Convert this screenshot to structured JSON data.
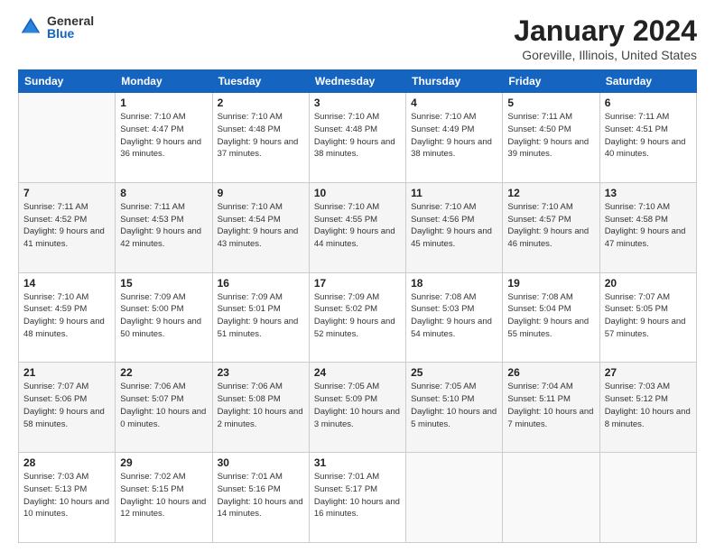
{
  "logo": {
    "general": "General",
    "blue": "Blue"
  },
  "title": {
    "month": "January 2024",
    "location": "Goreville, Illinois, United States"
  },
  "days_of_week": [
    "Sunday",
    "Monday",
    "Tuesday",
    "Wednesday",
    "Thursday",
    "Friday",
    "Saturday"
  ],
  "weeks": [
    [
      {
        "day": "",
        "sunrise": "",
        "sunset": "",
        "daylight": ""
      },
      {
        "day": "1",
        "sunrise": "Sunrise: 7:10 AM",
        "sunset": "Sunset: 4:47 PM",
        "daylight": "Daylight: 9 hours and 36 minutes."
      },
      {
        "day": "2",
        "sunrise": "Sunrise: 7:10 AM",
        "sunset": "Sunset: 4:48 PM",
        "daylight": "Daylight: 9 hours and 37 minutes."
      },
      {
        "day": "3",
        "sunrise": "Sunrise: 7:10 AM",
        "sunset": "Sunset: 4:48 PM",
        "daylight": "Daylight: 9 hours and 38 minutes."
      },
      {
        "day": "4",
        "sunrise": "Sunrise: 7:10 AM",
        "sunset": "Sunset: 4:49 PM",
        "daylight": "Daylight: 9 hours and 38 minutes."
      },
      {
        "day": "5",
        "sunrise": "Sunrise: 7:11 AM",
        "sunset": "Sunset: 4:50 PM",
        "daylight": "Daylight: 9 hours and 39 minutes."
      },
      {
        "day": "6",
        "sunrise": "Sunrise: 7:11 AM",
        "sunset": "Sunset: 4:51 PM",
        "daylight": "Daylight: 9 hours and 40 minutes."
      }
    ],
    [
      {
        "day": "7",
        "sunrise": "Sunrise: 7:11 AM",
        "sunset": "Sunset: 4:52 PM",
        "daylight": "Daylight: 9 hours and 41 minutes."
      },
      {
        "day": "8",
        "sunrise": "Sunrise: 7:11 AM",
        "sunset": "Sunset: 4:53 PM",
        "daylight": "Daylight: 9 hours and 42 minutes."
      },
      {
        "day": "9",
        "sunrise": "Sunrise: 7:10 AM",
        "sunset": "Sunset: 4:54 PM",
        "daylight": "Daylight: 9 hours and 43 minutes."
      },
      {
        "day": "10",
        "sunrise": "Sunrise: 7:10 AM",
        "sunset": "Sunset: 4:55 PM",
        "daylight": "Daylight: 9 hours and 44 minutes."
      },
      {
        "day": "11",
        "sunrise": "Sunrise: 7:10 AM",
        "sunset": "Sunset: 4:56 PM",
        "daylight": "Daylight: 9 hours and 45 minutes."
      },
      {
        "day": "12",
        "sunrise": "Sunrise: 7:10 AM",
        "sunset": "Sunset: 4:57 PM",
        "daylight": "Daylight: 9 hours and 46 minutes."
      },
      {
        "day": "13",
        "sunrise": "Sunrise: 7:10 AM",
        "sunset": "Sunset: 4:58 PM",
        "daylight": "Daylight: 9 hours and 47 minutes."
      }
    ],
    [
      {
        "day": "14",
        "sunrise": "Sunrise: 7:10 AM",
        "sunset": "Sunset: 4:59 PM",
        "daylight": "Daylight: 9 hours and 48 minutes."
      },
      {
        "day": "15",
        "sunrise": "Sunrise: 7:09 AM",
        "sunset": "Sunset: 5:00 PM",
        "daylight": "Daylight: 9 hours and 50 minutes."
      },
      {
        "day": "16",
        "sunrise": "Sunrise: 7:09 AM",
        "sunset": "Sunset: 5:01 PM",
        "daylight": "Daylight: 9 hours and 51 minutes."
      },
      {
        "day": "17",
        "sunrise": "Sunrise: 7:09 AM",
        "sunset": "Sunset: 5:02 PM",
        "daylight": "Daylight: 9 hours and 52 minutes."
      },
      {
        "day": "18",
        "sunrise": "Sunrise: 7:08 AM",
        "sunset": "Sunset: 5:03 PM",
        "daylight": "Daylight: 9 hours and 54 minutes."
      },
      {
        "day": "19",
        "sunrise": "Sunrise: 7:08 AM",
        "sunset": "Sunset: 5:04 PM",
        "daylight": "Daylight: 9 hours and 55 minutes."
      },
      {
        "day": "20",
        "sunrise": "Sunrise: 7:07 AM",
        "sunset": "Sunset: 5:05 PM",
        "daylight": "Daylight: 9 hours and 57 minutes."
      }
    ],
    [
      {
        "day": "21",
        "sunrise": "Sunrise: 7:07 AM",
        "sunset": "Sunset: 5:06 PM",
        "daylight": "Daylight: 9 hours and 58 minutes."
      },
      {
        "day": "22",
        "sunrise": "Sunrise: 7:06 AM",
        "sunset": "Sunset: 5:07 PM",
        "daylight": "Daylight: 10 hours and 0 minutes."
      },
      {
        "day": "23",
        "sunrise": "Sunrise: 7:06 AM",
        "sunset": "Sunset: 5:08 PM",
        "daylight": "Daylight: 10 hours and 2 minutes."
      },
      {
        "day": "24",
        "sunrise": "Sunrise: 7:05 AM",
        "sunset": "Sunset: 5:09 PM",
        "daylight": "Daylight: 10 hours and 3 minutes."
      },
      {
        "day": "25",
        "sunrise": "Sunrise: 7:05 AM",
        "sunset": "Sunset: 5:10 PM",
        "daylight": "Daylight: 10 hours and 5 minutes."
      },
      {
        "day": "26",
        "sunrise": "Sunrise: 7:04 AM",
        "sunset": "Sunset: 5:11 PM",
        "daylight": "Daylight: 10 hours and 7 minutes."
      },
      {
        "day": "27",
        "sunrise": "Sunrise: 7:03 AM",
        "sunset": "Sunset: 5:12 PM",
        "daylight": "Daylight: 10 hours and 8 minutes."
      }
    ],
    [
      {
        "day": "28",
        "sunrise": "Sunrise: 7:03 AM",
        "sunset": "Sunset: 5:13 PM",
        "daylight": "Daylight: 10 hours and 10 minutes."
      },
      {
        "day": "29",
        "sunrise": "Sunrise: 7:02 AM",
        "sunset": "Sunset: 5:15 PM",
        "daylight": "Daylight: 10 hours and 12 minutes."
      },
      {
        "day": "30",
        "sunrise": "Sunrise: 7:01 AM",
        "sunset": "Sunset: 5:16 PM",
        "daylight": "Daylight: 10 hours and 14 minutes."
      },
      {
        "day": "31",
        "sunrise": "Sunrise: 7:01 AM",
        "sunset": "Sunset: 5:17 PM",
        "daylight": "Daylight: 10 hours and 16 minutes."
      },
      {
        "day": "",
        "sunrise": "",
        "sunset": "",
        "daylight": ""
      },
      {
        "day": "",
        "sunrise": "",
        "sunset": "",
        "daylight": ""
      },
      {
        "day": "",
        "sunrise": "",
        "sunset": "",
        "daylight": ""
      }
    ]
  ]
}
